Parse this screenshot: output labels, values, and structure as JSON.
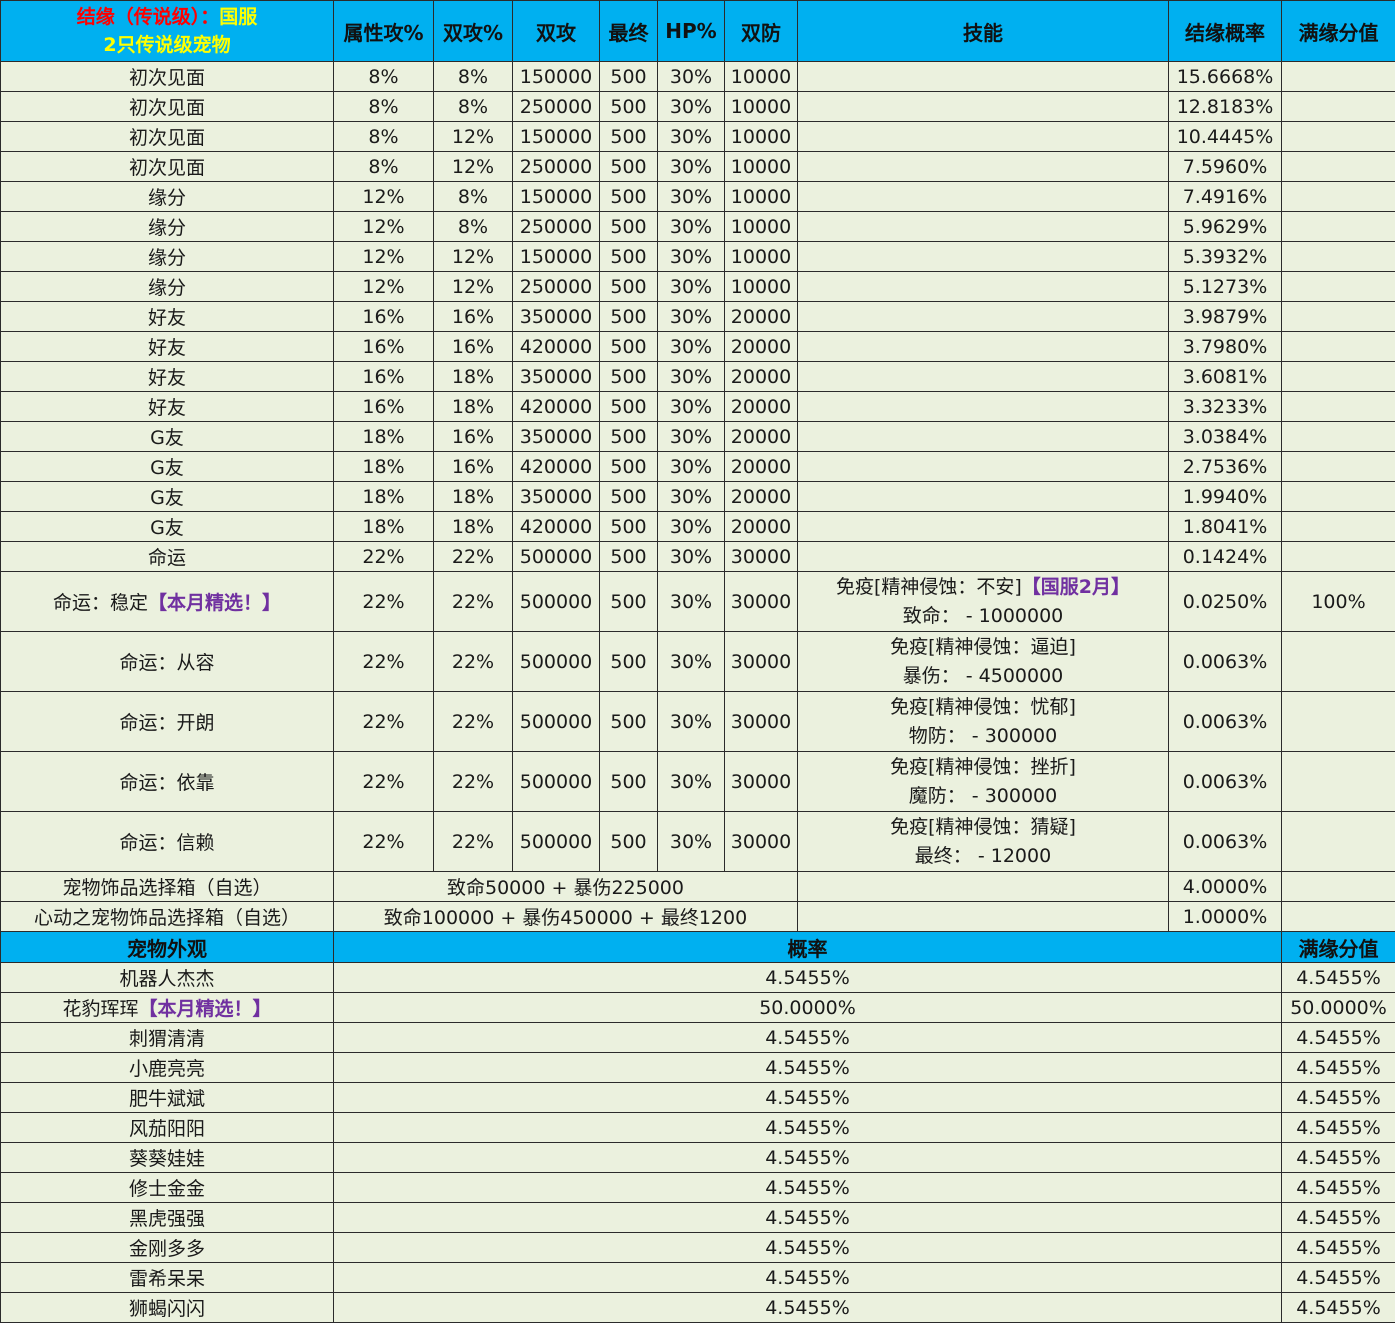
{
  "header": {
    "title_red": "结缘（传说级）：",
    "title_yellow": "国服",
    "subtitle": "2只传说级宠物",
    "cols": [
      "属性攻%",
      "双攻%",
      "双攻",
      "最终",
      "HP%",
      "双防",
      "技能",
      "结缘概率",
      "满缘分值"
    ]
  },
  "rows": [
    {
      "name": "初次见面",
      "c1": "8%",
      "c2": "8%",
      "c3": "150000",
      "c4": "500",
      "c5": "30%",
      "c6": "10000",
      "rate": "15.6668%"
    },
    {
      "name": "初次见面",
      "c1": "8%",
      "c2": "8%",
      "c3": "250000",
      "c4": "500",
      "c5": "30%",
      "c6": "10000",
      "rate": "12.8183%"
    },
    {
      "name": "初次见面",
      "c1": "8%",
      "c2": "12%",
      "c3": "150000",
      "c4": "500",
      "c5": "30%",
      "c6": "10000",
      "rate": "10.4445%"
    },
    {
      "name": "初次见面",
      "c1": "8%",
      "c2": "12%",
      "c3": "250000",
      "c4": "500",
      "c5": "30%",
      "c6": "10000",
      "rate": "7.5960%"
    },
    {
      "name": "缘分",
      "c1": "12%",
      "c2": "8%",
      "c3": "150000",
      "c4": "500",
      "c5": "30%",
      "c6": "10000",
      "rate": "7.4916%"
    },
    {
      "name": "缘分",
      "c1": "12%",
      "c2": "8%",
      "c3": "250000",
      "c4": "500",
      "c5": "30%",
      "c6": "10000",
      "rate": "5.9629%"
    },
    {
      "name": "缘分",
      "c1": "12%",
      "c2": "12%",
      "c3": "150000",
      "c4": "500",
      "c5": "30%",
      "c6": "10000",
      "rate": "5.3932%"
    },
    {
      "name": "缘分",
      "c1": "12%",
      "c2": "12%",
      "c3": "250000",
      "c4": "500",
      "c5": "30%",
      "c6": "10000",
      "rate": "5.1273%"
    },
    {
      "name": "好友",
      "c1": "16%",
      "c2": "16%",
      "c3": "350000",
      "c4": "500",
      "c5": "30%",
      "c6": "20000",
      "rate": "3.9879%"
    },
    {
      "name": "好友",
      "c1": "16%",
      "c2": "16%",
      "c3": "420000",
      "c4": "500",
      "c5": "30%",
      "c6": "20000",
      "rate": "3.7980%"
    },
    {
      "name": "好友",
      "c1": "16%",
      "c2": "18%",
      "c3": "350000",
      "c4": "500",
      "c5": "30%",
      "c6": "20000",
      "rate": "3.6081%"
    },
    {
      "name": "好友",
      "c1": "16%",
      "c2": "18%",
      "c3": "420000",
      "c4": "500",
      "c5": "30%",
      "c6": "20000",
      "rate": "3.3233%"
    },
    {
      "name": "G友",
      "c1": "18%",
      "c2": "16%",
      "c3": "350000",
      "c4": "500",
      "c5": "30%",
      "c6": "20000",
      "rate": "3.0384%"
    },
    {
      "name": "G友",
      "c1": "18%",
      "c2": "16%",
      "c3": "420000",
      "c4": "500",
      "c5": "30%",
      "c6": "20000",
      "rate": "2.7536%"
    },
    {
      "name": "G友",
      "c1": "18%",
      "c2": "18%",
      "c3": "350000",
      "c4": "500",
      "c5": "30%",
      "c6": "20000",
      "rate": "1.9940%"
    },
    {
      "name": "G友",
      "c1": "18%",
      "c2": "18%",
      "c3": "420000",
      "c4": "500",
      "c5": "30%",
      "c6": "20000",
      "rate": "1.8041%"
    },
    {
      "name": "命运",
      "c1": "22%",
      "c2": "22%",
      "c3": "500000",
      "c4": "500",
      "c5": "30%",
      "c6": "30000",
      "rate": "0.1424%"
    }
  ],
  "fate_rows": [
    {
      "name": "命运：稳定",
      "name_tag": "【本月精选！】",
      "c1": "22%",
      "c2": "22%",
      "c3": "500000",
      "c4": "500",
      "c5": "30%",
      "c6": "30000",
      "skill1": "免疫[精神侵蚀：不安]",
      "skill1_tag": "【国服2月】",
      "skill2": "致命：  - 1000000",
      "rate": "0.0250%",
      "score": "100%"
    },
    {
      "name": "命运：从容",
      "name_tag": "",
      "c1": "22%",
      "c2": "22%",
      "c3": "500000",
      "c4": "500",
      "c5": "30%",
      "c6": "30000",
      "skill1": "免疫[精神侵蚀：逼迫]",
      "skill1_tag": "",
      "skill2": "暴伤：  - 4500000",
      "rate": "0.0063%",
      "score": ""
    },
    {
      "name": "命运：开朗",
      "name_tag": "",
      "c1": "22%",
      "c2": "22%",
      "c3": "500000",
      "c4": "500",
      "c5": "30%",
      "c6": "30000",
      "skill1": "免疫[精神侵蚀：忧郁]",
      "skill1_tag": "",
      "skill2": "物防：  - 300000",
      "rate": "0.0063%",
      "score": ""
    },
    {
      "name": "命运：依靠",
      "name_tag": "",
      "c1": "22%",
      "c2": "22%",
      "c3": "500000",
      "c4": "500",
      "c5": "30%",
      "c6": "30000",
      "skill1": "免疫[精神侵蚀：挫折]",
      "skill1_tag": "",
      "skill2": "魔防：  - 300000",
      "rate": "0.0063%",
      "score": ""
    },
    {
      "name": "命运：信赖",
      "name_tag": "",
      "c1": "22%",
      "c2": "22%",
      "c3": "500000",
      "c4": "500",
      "c5": "30%",
      "c6": "30000",
      "skill1": "免疫[精神侵蚀：猜疑]",
      "skill1_tag": "",
      "skill2": "最终：  - 12000",
      "rate": "0.0063%",
      "score": ""
    }
  ],
  "box_rows": [
    {
      "name": "宠物饰品选择箱（自选）",
      "value": "致命50000 + 暴伤225000",
      "rate": "4.0000%"
    },
    {
      "name": "心动之宠物饰品选择箱（自选）",
      "value": "致命100000 + 暴伤450000 + 最终1200",
      "rate": "1.0000%"
    }
  ],
  "appearance_header": {
    "name": "宠物外观",
    "rate": "概率",
    "score": "满缘分值"
  },
  "appearance_rows": [
    {
      "name": "机器人杰杰",
      "tag": "",
      "rate": "4.5455%",
      "score": "4.5455%"
    },
    {
      "name": "花豹珲珲",
      "tag": "【本月精选！】",
      "rate": "50.0000%",
      "score": "50.0000%"
    },
    {
      "name": "刺猬清清",
      "tag": "",
      "rate": "4.5455%",
      "score": "4.5455%"
    },
    {
      "name": "小鹿亮亮",
      "tag": "",
      "rate": "4.5455%",
      "score": "4.5455%"
    },
    {
      "name": "肥牛斌斌",
      "tag": "",
      "rate": "4.5455%",
      "score": "4.5455%"
    },
    {
      "name": "风茄阳阳",
      "tag": "",
      "rate": "4.5455%",
      "score": "4.5455%"
    },
    {
      "name": "葵葵娃娃",
      "tag": "",
      "rate": "4.5455%",
      "score": "4.5455%"
    },
    {
      "name": "修士金金",
      "tag": "",
      "rate": "4.5455%",
      "score": "4.5455%"
    },
    {
      "name": "黑虎强强",
      "tag": "",
      "rate": "4.5455%",
      "score": "4.5455%"
    },
    {
      "name": "金刚多多",
      "tag": "",
      "rate": "4.5455%",
      "score": "4.5455%"
    },
    {
      "name": "雷希呆呆",
      "tag": "",
      "rate": "4.5455%",
      "score": "4.5455%"
    },
    {
      "name": "狮蝎闪闪",
      "tag": "",
      "rate": "4.5455%",
      "score": "4.5455%"
    }
  ]
}
